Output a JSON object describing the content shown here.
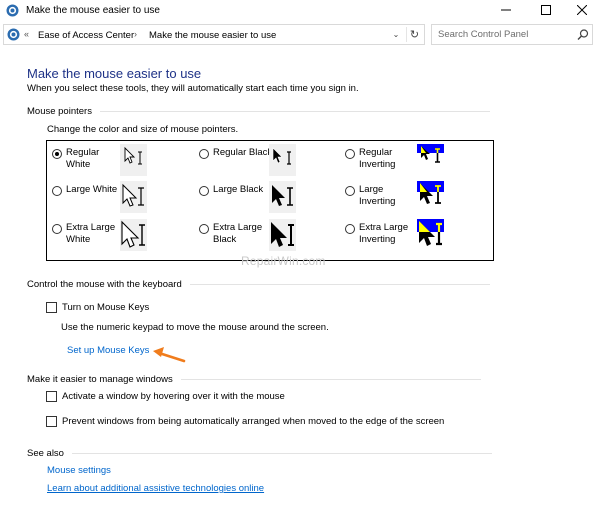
{
  "window": {
    "title": "Make the mouse easier to use",
    "app_icon": "ease-of-access-icon",
    "controls": [
      "minimize-icon",
      "maximize-icon",
      "close-icon"
    ]
  },
  "address_bar": {
    "chevron": "«",
    "breadcrumbs": [
      "Ease of Access Center",
      "Make the mouse easier to use"
    ],
    "separator": "›",
    "dropdown_glyph": "⌄",
    "refresh_glyph": "↻"
  },
  "search": {
    "placeholder": "Search Control Panel",
    "icon": "search-icon"
  },
  "page": {
    "title": "Make the mouse easier to use",
    "subtitle": "When you select these tools, they will automatically start each time you sign in."
  },
  "mouse_pointers": {
    "heading": "Mouse pointers",
    "description": "Change the color and size of mouse pointers.",
    "options": [
      {
        "label": [
          "Regular",
          "White"
        ],
        "selected": true,
        "scheme": "white",
        "size": "regular"
      },
      {
        "label": [
          "Regular Black",
          ""
        ],
        "selected": false,
        "scheme": "black",
        "size": "regular"
      },
      {
        "label": [
          "Regular",
          "Inverting"
        ],
        "selected": false,
        "scheme": "inverting",
        "size": "regular"
      },
      {
        "label": [
          "Large White",
          ""
        ],
        "selected": false,
        "scheme": "white",
        "size": "large"
      },
      {
        "label": [
          "Large Black",
          ""
        ],
        "selected": false,
        "scheme": "black",
        "size": "large"
      },
      {
        "label": [
          "Large",
          "Inverting"
        ],
        "selected": false,
        "scheme": "inverting",
        "size": "large"
      },
      {
        "label": [
          "Extra Large",
          "White"
        ],
        "selected": false,
        "scheme": "white",
        "size": "xlarge"
      },
      {
        "label": [
          "Extra Large",
          "Black"
        ],
        "selected": false,
        "scheme": "black",
        "size": "xlarge"
      },
      {
        "label": [
          "Extra Large",
          "Inverting"
        ],
        "selected": false,
        "scheme": "inverting",
        "size": "xlarge"
      }
    ]
  },
  "keyboard": {
    "heading": "Control the mouse with the keyboard",
    "mouse_keys_label": "Turn on Mouse Keys",
    "mouse_keys_checked": false,
    "mouse_keys_desc": "Use the numeric keypad to move the mouse around the screen.",
    "setup_link": "Set up Mouse Keys"
  },
  "windows": {
    "heading": "Make it easier to manage windows",
    "hover_label": "Activate a window by hovering over it with the mouse",
    "hover_checked": false,
    "snap_label": "Prevent windows from being automatically arranged when moved to the edge of the screen",
    "snap_checked": false
  },
  "see_also": {
    "heading": "See also",
    "links": [
      "Mouse settings",
      "Learn about additional assistive technologies online"
    ]
  },
  "watermark": "RepairWin.com",
  "colors": {
    "title_blue": "#1e3287",
    "link_blue": "#0066cc",
    "inverting_blue": "#0000ff",
    "inverting_yellow": "#ffff00",
    "arrow_orange": "#f07c1c"
  }
}
